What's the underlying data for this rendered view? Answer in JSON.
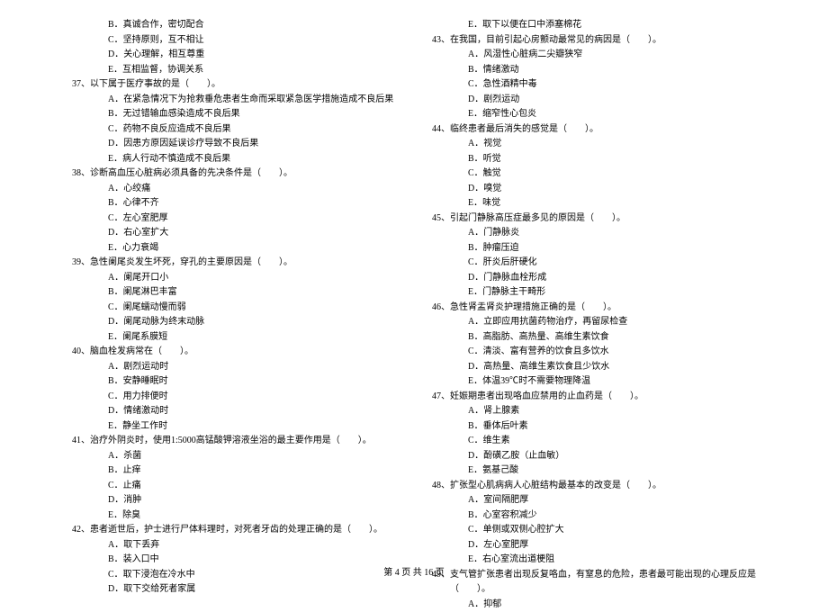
{
  "left_column": {
    "pre_options": [
      "B．真诚合作，密切配合",
      "C．坚持原则，互不相让",
      "D．关心理解，相互尊重",
      "E．互相监督，协调关系"
    ],
    "questions": [
      {
        "num": "37、",
        "stem": "以下属于医疗事故的是（　　）。",
        "opts": [
          "A．在紧急情况下为抢救垂危患者生命而采取紧急医学措施造成不良后果",
          "B．无过错输血感染造成不良后果",
          "C．药物不良反应造成不良后果",
          "D．因患方原因延误诊疗导致不良后果",
          "E．病人行动不慎造成不良后果"
        ]
      },
      {
        "num": "38、",
        "stem": "诊断高血压心脏病必须具备的先决条件是（　　）。",
        "opts": [
          "A．心绞痛",
          "B．心律不齐",
          "C．左心室肥厚",
          "D．右心室扩大",
          "E．心力衰竭"
        ]
      },
      {
        "num": "39、",
        "stem": "急性阑尾炎发生坏死，穿孔的主要原因是（　　）。",
        "opts": [
          "A．阑尾开口小",
          "B．阑尾淋巴丰富",
          "C．阑尾蠕动慢而弱",
          "D．阑尾动脉为终末动脉",
          "E．阑尾系膜短"
        ]
      },
      {
        "num": "40、",
        "stem": "脑血栓发病常在（　　）。",
        "opts": [
          "A．剧烈运动时",
          "B．安静睡眠时",
          "C．用力排便时",
          "D．情绪激动时",
          "E．静坐工作时"
        ]
      },
      {
        "num": "41、",
        "stem": "治疗外阴炎时，使用1:5000高锰酸钾溶液坐浴的最主要作用是（　　）。",
        "opts": [
          "A．杀菌",
          "B．止痒",
          "C．止痛",
          "D．消肿",
          "E．除臭"
        ]
      },
      {
        "num": "42、",
        "stem": "患者逝世后，护士进行尸体料理时，对死者牙齿的处理正确的是（　　）。",
        "opts": [
          "A．取下丢弃",
          "B．装入口中",
          "C．取下浸泡在冷水中",
          "D．取下交给死者家属"
        ]
      }
    ]
  },
  "right_column": {
    "pre_options": [
      "E．取下以便在口中添塞棉花"
    ],
    "questions": [
      {
        "num": "43、",
        "stem": "在我国，目前引起心房颤动最常见的病因是（　　）。",
        "opts": [
          "A．风湿性心脏病二尖瓣狭窄",
          "B．情绪激动",
          "C．急性酒精中毒",
          "D．剧烈运动",
          "E．缩窄性心包炎"
        ]
      },
      {
        "num": "44、",
        "stem": "临终患者最后消失的感觉是（　　）。",
        "opts": [
          "A．视觉",
          "B．听觉",
          "C．触觉",
          "D．嗅觉",
          "E．味觉"
        ]
      },
      {
        "num": "45、",
        "stem": "引起门静脉高压症最多见的原因是（　　）。",
        "opts": [
          "A．门静脉炎",
          "B．肿瘤压迫",
          "C．肝炎后肝硬化",
          "D．门静脉血栓形成",
          "E．门静脉主干畸形"
        ]
      },
      {
        "num": "46、",
        "stem": "急性肾盂肾炎护理措施正确的是（　　）。",
        "opts": [
          "A．立即应用抗菌药物治疗，再留尿检查",
          "B．高脂肪、高热量、高维生素饮食",
          "C．清淡、富有营养的饮食且多饮水",
          "D．高热量、高维生素饮食且少饮水",
          "E．体温39℃时不需要物理降温"
        ]
      },
      {
        "num": "47、",
        "stem": "妊娠期患者出现咯血应禁用的止血药是（　　）。",
        "opts": [
          "A．肾上腺素",
          "B．垂体后叶素",
          "C．维生素",
          "D．酚磺乙胺（止血敏）",
          "E．氨基己酸"
        ]
      },
      {
        "num": "48、",
        "stem": "扩张型心肌病病人心脏结构最基本的改变是（　　）。",
        "opts": [
          "A．室间隔肥厚",
          "B．心室容积减少",
          "C．单侧或双侧心腔扩大",
          "D．左心室肥厚",
          "E．右心室流出道梗阻"
        ]
      },
      {
        "num": "49、",
        "stem": "支气管扩张患者出现反复咯血，有窒息的危险，患者最可能出现的心理反应是（　　）。",
        "opts": [
          "A．抑郁"
        ]
      }
    ]
  },
  "footer": "第 4 页  共 16 页"
}
